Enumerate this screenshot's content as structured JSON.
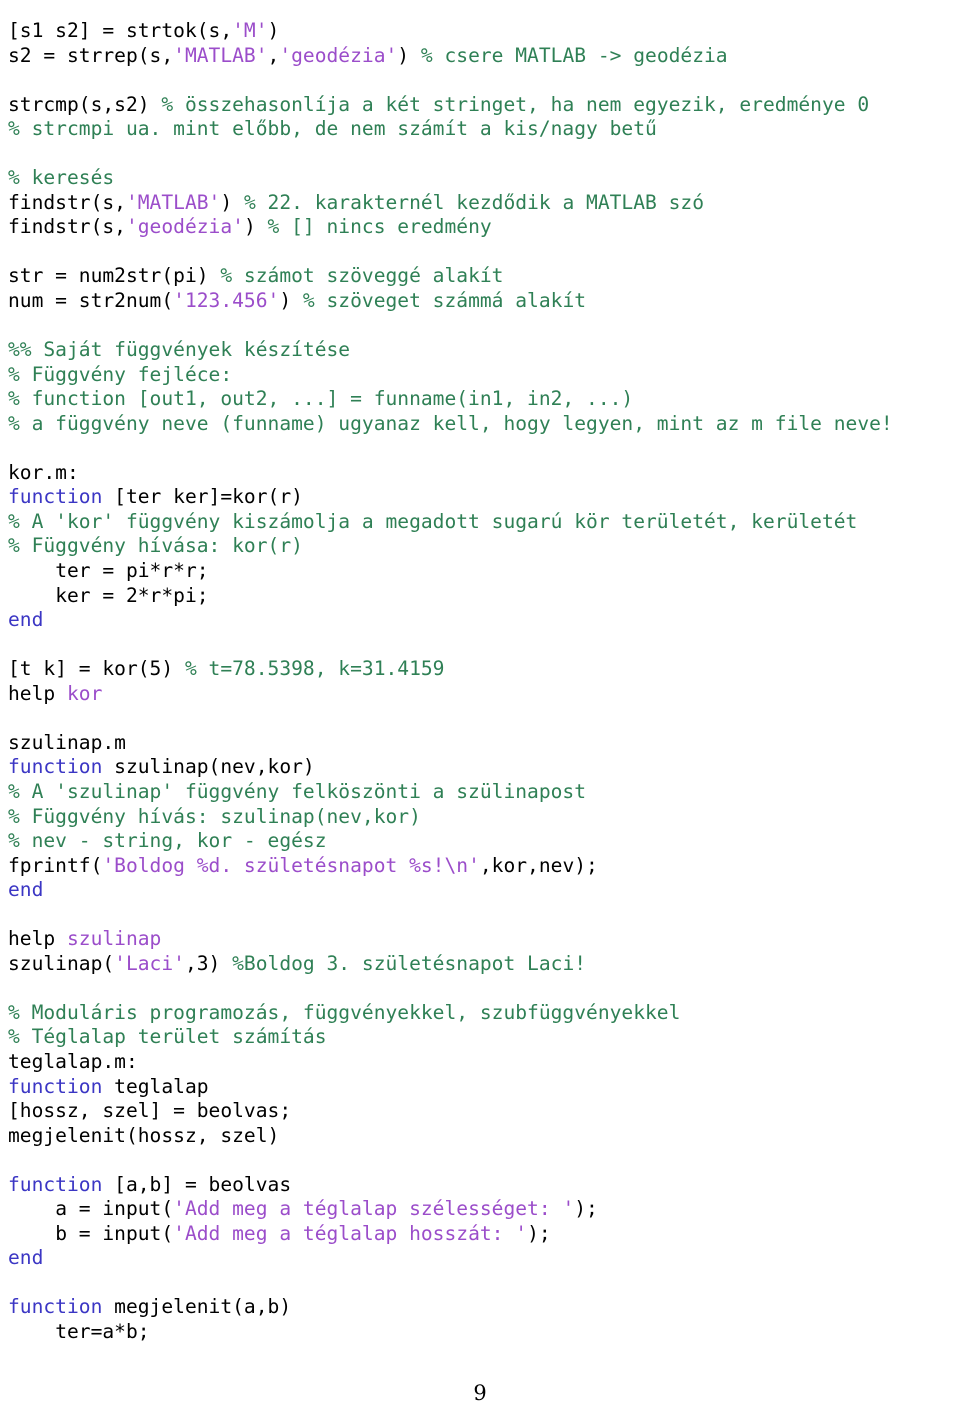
{
  "document": {
    "page_number": "9",
    "language": "MATLAB",
    "colors": {
      "plain": "#000000",
      "comment": "#2f8055",
      "string": "#9b4dca",
      "keyword": "#3b36c4",
      "background": "#ffffff"
    }
  },
  "code_lines": [
    {
      "indent": 0,
      "tokens": [
        {
          "t": "plain",
          "s": "[s1 s2] = strtok(s,"
        },
        {
          "t": "string",
          "s": "'M'"
        },
        {
          "t": "plain",
          "s": ")"
        }
      ]
    },
    {
      "indent": 0,
      "tokens": [
        {
          "t": "plain",
          "s": "s2 = strrep(s,"
        },
        {
          "t": "string",
          "s": "'MATLAB'"
        },
        {
          "t": "plain",
          "s": ","
        },
        {
          "t": "string",
          "s": "'geodézia'"
        },
        {
          "t": "plain",
          "s": ") "
        },
        {
          "t": "comment",
          "s": "% csere MATLAB -> geodézia"
        }
      ]
    },
    {
      "indent": 0,
      "tokens": []
    },
    {
      "indent": 0,
      "tokens": [
        {
          "t": "plain",
          "s": "strcmp(s,s2) "
        },
        {
          "t": "comment",
          "s": "% összehasonlíja a két stringet, ha nem egyezik, eredménye 0"
        }
      ]
    },
    {
      "indent": 0,
      "tokens": [
        {
          "t": "comment",
          "s": "% strcmpi ua. mint előbb, de nem számít a kis/nagy betű"
        }
      ]
    },
    {
      "indent": 0,
      "tokens": []
    },
    {
      "indent": 0,
      "tokens": [
        {
          "t": "comment",
          "s": "% keresés"
        }
      ]
    },
    {
      "indent": 0,
      "tokens": [
        {
          "t": "plain",
          "s": "findstr(s,"
        },
        {
          "t": "string",
          "s": "'MATLAB'"
        },
        {
          "t": "plain",
          "s": ") "
        },
        {
          "t": "comment",
          "s": "% 22. karakternél kezdődik a MATLAB szó"
        }
      ]
    },
    {
      "indent": 0,
      "tokens": [
        {
          "t": "plain",
          "s": "findstr(s,"
        },
        {
          "t": "string",
          "s": "'geodézia'"
        },
        {
          "t": "plain",
          "s": ") "
        },
        {
          "t": "comment",
          "s": "% [] nincs eredmény"
        }
      ]
    },
    {
      "indent": 0,
      "tokens": []
    },
    {
      "indent": 0,
      "tokens": [
        {
          "t": "plain",
          "s": "str = num2str(pi) "
        },
        {
          "t": "comment",
          "s": "% számot szöveggé alakít"
        }
      ]
    },
    {
      "indent": 0,
      "tokens": [
        {
          "t": "plain",
          "s": "num = str2num("
        },
        {
          "t": "string",
          "s": "'123.456'"
        },
        {
          "t": "plain",
          "s": ") "
        },
        {
          "t": "comment",
          "s": "% szöveget számmá alakít"
        }
      ]
    },
    {
      "indent": 0,
      "tokens": []
    },
    {
      "indent": 0,
      "tokens": [
        {
          "t": "comment",
          "s": "%% Saját függvények készítése"
        }
      ]
    },
    {
      "indent": 0,
      "tokens": [
        {
          "t": "comment",
          "s": "% Függvény fejléce:"
        }
      ]
    },
    {
      "indent": 0,
      "tokens": [
        {
          "t": "comment",
          "s": "% function [out1, out2, ...] = funname(in1, in2, ...)"
        }
      ]
    },
    {
      "indent": 0,
      "tokens": [
        {
          "t": "comment",
          "s": "% a függvény neve (funname) ugyanaz kell, hogy legyen, mint az m file neve!"
        }
      ]
    },
    {
      "indent": 0,
      "tokens": []
    },
    {
      "indent": 0,
      "tokens": [
        {
          "t": "plain",
          "s": "kor.m:"
        }
      ]
    },
    {
      "indent": 0,
      "tokens": [
        {
          "t": "keyword",
          "s": "function"
        },
        {
          "t": "plain",
          "s": " [ter ker]=kor(r)"
        }
      ]
    },
    {
      "indent": 0,
      "tokens": [
        {
          "t": "comment",
          "s": "% A 'kor' függvény kiszámolja a megadott sugarú kör területét, kerületét"
        }
      ]
    },
    {
      "indent": 0,
      "tokens": [
        {
          "t": "comment",
          "s": "% Függvény hívása: kor(r)"
        }
      ]
    },
    {
      "indent": 1,
      "tokens": [
        {
          "t": "plain",
          "s": "ter = pi*r*r;"
        }
      ]
    },
    {
      "indent": 1,
      "tokens": [
        {
          "t": "plain",
          "s": "ker = 2*r*pi;"
        }
      ]
    },
    {
      "indent": 0,
      "tokens": [
        {
          "t": "keyword",
          "s": "end"
        }
      ]
    },
    {
      "indent": 0,
      "tokens": []
    },
    {
      "indent": 0,
      "tokens": [
        {
          "t": "plain",
          "s": "[t k] = kor(5) "
        },
        {
          "t": "comment",
          "s": "% t=78.5398, k=31.4159"
        }
      ]
    },
    {
      "indent": 0,
      "tokens": [
        {
          "t": "plain",
          "s": "help "
        },
        {
          "t": "string",
          "s": "kor"
        }
      ]
    },
    {
      "indent": 0,
      "tokens": []
    },
    {
      "indent": 0,
      "tokens": [
        {
          "t": "plain",
          "s": "szulinap.m"
        }
      ]
    },
    {
      "indent": 0,
      "tokens": [
        {
          "t": "keyword",
          "s": "function"
        },
        {
          "t": "plain",
          "s": " szulinap(nev,kor)"
        }
      ]
    },
    {
      "indent": 0,
      "tokens": [
        {
          "t": "comment",
          "s": "% A 'szulinap' függvény felköszönti a szülinapost"
        }
      ]
    },
    {
      "indent": 0,
      "tokens": [
        {
          "t": "comment",
          "s": "% Függvény hívás: szulinap(nev,kor)"
        }
      ]
    },
    {
      "indent": 0,
      "tokens": [
        {
          "t": "comment",
          "s": "% nev - string, kor - egész"
        }
      ]
    },
    {
      "indent": 0,
      "tokens": [
        {
          "t": "plain",
          "s": "fprintf("
        },
        {
          "t": "string",
          "s": "'Boldog %d. születésnapot %s!\\n'"
        },
        {
          "t": "plain",
          "s": ",kor,nev);"
        }
      ]
    },
    {
      "indent": 0,
      "tokens": [
        {
          "t": "keyword",
          "s": "end"
        }
      ]
    },
    {
      "indent": 0,
      "tokens": []
    },
    {
      "indent": 0,
      "tokens": [
        {
          "t": "plain",
          "s": "help "
        },
        {
          "t": "string",
          "s": "szulinap"
        }
      ]
    },
    {
      "indent": 0,
      "tokens": [
        {
          "t": "plain",
          "s": "szulinap("
        },
        {
          "t": "string",
          "s": "'Laci'"
        },
        {
          "t": "plain",
          "s": ",3) "
        },
        {
          "t": "comment",
          "s": "%Boldog 3. születésnapot Laci!"
        }
      ]
    },
    {
      "indent": 0,
      "tokens": []
    },
    {
      "indent": 0,
      "tokens": [
        {
          "t": "comment",
          "s": "% Moduláris programozás, függvényekkel, szubfüggvényekkel"
        }
      ]
    },
    {
      "indent": 0,
      "tokens": [
        {
          "t": "comment",
          "s": "% Téglalap terület számítás"
        }
      ]
    },
    {
      "indent": 0,
      "tokens": [
        {
          "t": "plain",
          "s": "teglalap.m:"
        }
      ]
    },
    {
      "indent": 0,
      "tokens": [
        {
          "t": "keyword",
          "s": "function"
        },
        {
          "t": "plain",
          "s": " teglalap"
        }
      ]
    },
    {
      "indent": 0,
      "tokens": [
        {
          "t": "plain",
          "s": "[hossz, szel] = beolvas;"
        }
      ]
    },
    {
      "indent": 0,
      "tokens": [
        {
          "t": "plain",
          "s": "megjelenit(hossz, szel)"
        }
      ]
    },
    {
      "indent": 0,
      "tokens": []
    },
    {
      "indent": 0,
      "tokens": [
        {
          "t": "keyword",
          "s": "function"
        },
        {
          "t": "plain",
          "s": " [a,b] = beolvas"
        }
      ]
    },
    {
      "indent": 1,
      "tokens": [
        {
          "t": "plain",
          "s": "a = input("
        },
        {
          "t": "string",
          "s": "'Add meg a téglalap szélességet: '"
        },
        {
          "t": "plain",
          "s": ");"
        }
      ]
    },
    {
      "indent": 1,
      "tokens": [
        {
          "t": "plain",
          "s": "b = input("
        },
        {
          "t": "string",
          "s": "'Add meg a téglalap hosszát: '"
        },
        {
          "t": "plain",
          "s": ");"
        }
      ]
    },
    {
      "indent": 0,
      "tokens": [
        {
          "t": "keyword",
          "s": "end"
        }
      ]
    },
    {
      "indent": 0,
      "tokens": []
    },
    {
      "indent": 0,
      "tokens": [
        {
          "t": "keyword",
          "s": "function"
        },
        {
          "t": "plain",
          "s": " megjelenit(a,b)"
        }
      ]
    },
    {
      "indent": 1,
      "tokens": [
        {
          "t": "plain",
          "s": "ter=a*b;"
        }
      ]
    }
  ]
}
